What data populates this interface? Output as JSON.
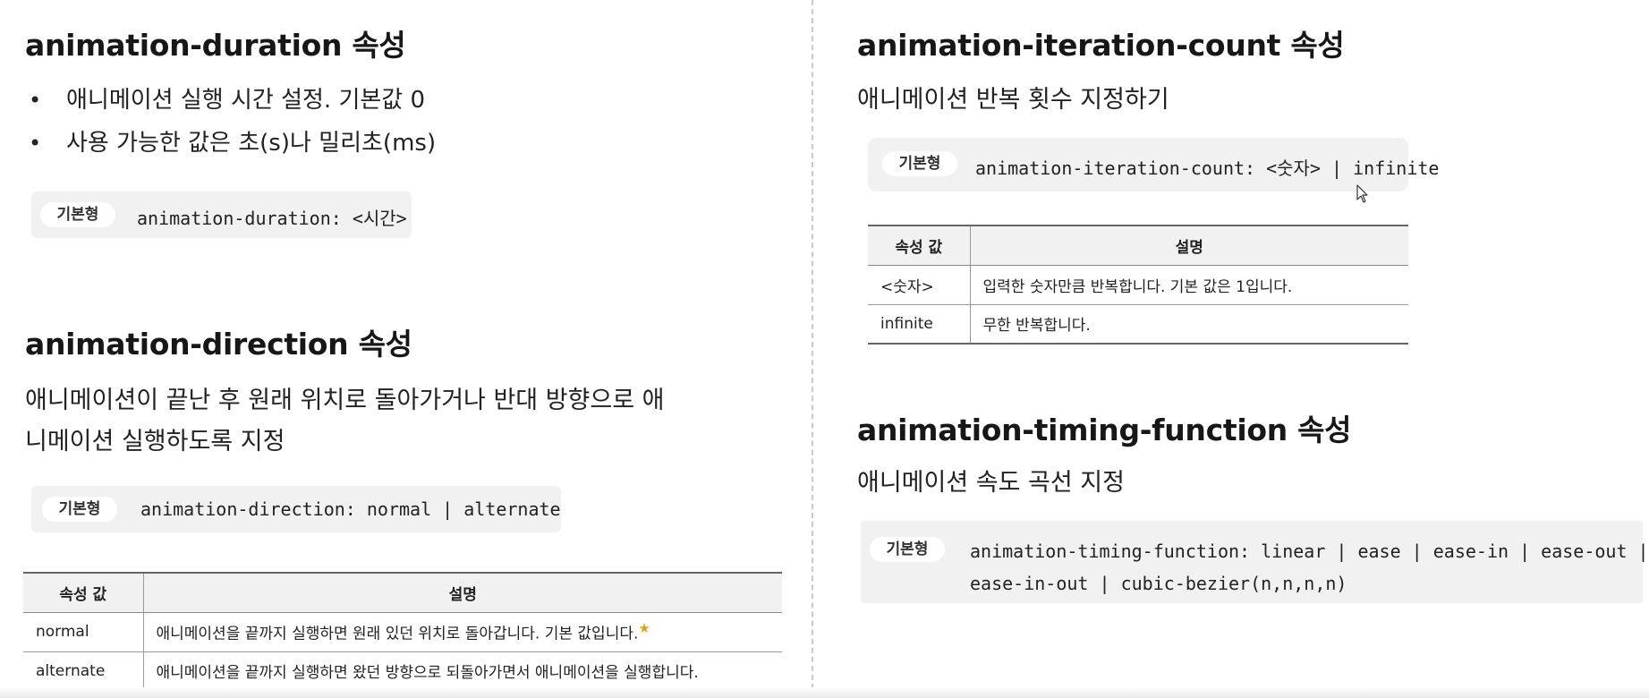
{
  "left": {
    "duration": {
      "title": "animation-duration 속성",
      "bullets": [
        "애니메이션 실행 시간 설정. 기본값 0",
        "사용 가능한 값은 초(s)나 밀리초(ms)"
      ],
      "tag": "기본형",
      "code": "animation-duration: <시간>"
    },
    "direction": {
      "title": "animation-direction 속성",
      "desc_line1": "애니메이션이 끝난 후 원래 위치로 돌아가거나 반대 방향으로 애",
      "desc_line2": "니메이션 실행하도록 지정",
      "tag": "기본형",
      "code": "animation-direction: normal | alternate",
      "table": {
        "headers": [
          "속성 값",
          "설명"
        ],
        "rows": [
          {
            "value": "normal",
            "desc": "애니메이션을 끝까지 실행하면 원래 있던 위치로 돌아갑니다. 기본 값입니다."
          },
          {
            "value": "alternate",
            "desc": "애니메이션을 끝까지 실행하면 왔던 방향으로 되돌아가면서 애니메이션을 실행합니다."
          }
        ]
      }
    }
  },
  "right": {
    "iteration": {
      "title": "animation-iteration-count 속성",
      "desc": "애니메이션 반복 횟수 지정하기",
      "tag": "기본형",
      "code": "animation-iteration-count: <숫자> | infinite",
      "table": {
        "headers": [
          "속성 값",
          "설명"
        ],
        "rows": [
          {
            "value": "<숫자>",
            "desc": "입력한 숫자만큼 반복합니다. 기본 값은 1입니다."
          },
          {
            "value": "infinite",
            "desc": "무한 반복합니다."
          }
        ]
      }
    },
    "timing": {
      "title": "animation-timing-function 속성",
      "desc": "애니메이션 속도 곡선 지정",
      "tag": "기본형",
      "code_line1": "animation-timing-function: linear | ease | ease-in | ease-out |",
      "code_line2": "ease-in-out | cubic-bezier(n,n,n,n)"
    }
  },
  "icons": {
    "star": "star-icon",
    "cursor": "mouse-pointer-icon"
  }
}
